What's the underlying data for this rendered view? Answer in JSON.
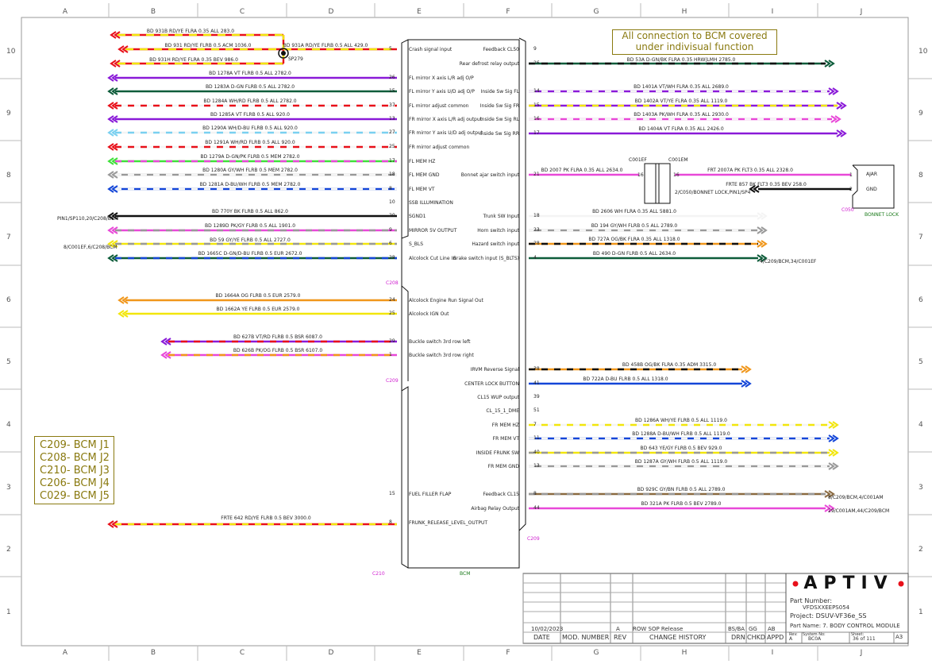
{
  "zones_top": [
    "A",
    "B",
    "C",
    "D",
    "E",
    "F",
    "G",
    "H",
    "I",
    "J"
  ],
  "rows": [
    "10",
    "9",
    "8",
    "7",
    "6",
    "5",
    "4",
    "3",
    "2",
    "1"
  ],
  "note": "All connection to BCM covered under indivisual function",
  "legend": [
    "C209- BCM J1",
    "C208- BCM J2",
    "C210- BCM J3",
    "C206- BCM J4",
    "C029- BCM J5"
  ],
  "component": {
    "label": "BCM",
    "connectors": [
      "C208",
      "C209",
      "C210",
      "C209"
    ]
  },
  "splice": "SP279",
  "left_signals": [
    {
      "pin": "5",
      "label": "Crash signal input"
    },
    {
      "pin": "26",
      "label": "FL mirror X axis L/R adj O/P"
    },
    {
      "pin": "15",
      "label": "FL mirror Y axis U/D adj O/P"
    },
    {
      "pin": "37",
      "label": "FL mirror adjust common"
    },
    {
      "pin": "13",
      "label": "FR mirror X axis L/R adj output"
    },
    {
      "pin": "27",
      "label": "FR mirror Y axis U/D adj output"
    },
    {
      "pin": "25",
      "label": "FR mirror adjust common"
    },
    {
      "pin": "17",
      "label": "FL MEM HZ"
    },
    {
      "pin": "18",
      "label": "FL MEM GND"
    },
    {
      "pin": "8",
      "label": "FL MEM VT"
    },
    {
      "pin": "10",
      "label": "SSB ILLUMINATION"
    },
    {
      "pin": "20",
      "label": "SGND1"
    },
    {
      "pin": "9",
      "label": "MIRROR 5V OUTPUT"
    },
    {
      "pin": "6",
      "label": "S_BLS"
    },
    {
      "pin": "28",
      "label": "Alcolock Cut Line In"
    },
    {
      "pin": "24",
      "label": "Alcolock Engine Run Signal Out"
    },
    {
      "pin": "25",
      "label": "Alcolock IGN Out"
    },
    {
      "pin": "29",
      "label": "Buckle switch 3rd row left"
    },
    {
      "pin": "1",
      "label": "Buckle switch 3rd row right"
    },
    {
      "pin": "15",
      "label": "FUEL FILLER FLAP"
    },
    {
      "pin": "8",
      "label": "FRUNK_RELEASE_LEVEL_OUTPUT"
    }
  ],
  "right_signals": [
    {
      "pin": "9",
      "label": "Feedback CL50"
    },
    {
      "pin": "26",
      "label": "Rear defrost relay output"
    },
    {
      "pin": "14",
      "label": "Inside Sw Sig FL"
    },
    {
      "pin": "15",
      "label": "Inside Sw Sig FR"
    },
    {
      "pin": "16",
      "label": "Inside Sw Sig RL"
    },
    {
      "pin": "17",
      "label": "Inside Sw Sig RR"
    },
    {
      "pin": "21",
      "label": "Bonnet ajar switch input"
    },
    {
      "pin": "18",
      "label": "Trunk SW Input"
    },
    {
      "pin": "23",
      "label": "Horn switch input"
    },
    {
      "pin": "28",
      "label": "Hazard switch input"
    },
    {
      "pin": "4",
      "label": "Brake switch input (S_BLTS)"
    },
    {
      "pin": "38",
      "label": "IRVM Reverse Signal"
    },
    {
      "pin": "41",
      "label": "CENTER LOCK BUTTON"
    },
    {
      "pin": "39",
      "label": "CL15 WUP output"
    },
    {
      "pin": "51",
      "label": "CL_15_1_DME"
    },
    {
      "pin": "7",
      "label": "FR MEM HZ"
    },
    {
      "pin": "11",
      "label": "FR MEM VT"
    },
    {
      "pin": "40",
      "label": "INSIDE FRUNK SW"
    },
    {
      "pin": "13",
      "label": "FR MEM GND"
    },
    {
      "pin": "8",
      "label": "Feedback CL15"
    },
    {
      "pin": "44",
      "label": "Airbag Relay Output"
    }
  ],
  "left_wires": [
    "BD 931B RD/YE FLRA 0.35 ALL 283.0",
    "BD 931 RD/YE FLRB 0.5 ACM 1036.0",
    "BD 931H RD/YE FLRA 0.35 BEV 986.0",
    "BD 931A RD/YE FLRB 0.5 ALL 429.0",
    "BD 1278A VT FLRB 0.5 ALL 2782.0",
    "BD 1283A D-GN FLRB 0.5 ALL 2782.0",
    "BD 1284A WH/RD FLRB 0.5 ALL 2782.0",
    "BD 1285A VT FLRB 0.5 ALL 920.0",
    "BD 1290A WH/D-BU FLRB 0.5 ALL 920.0",
    "BD 1291A WH/RD FLRB 0.5 ALL 920.0",
    "BD 1279A D-GN/PK FLRB 0.5 MEM 2782.0",
    "BD 1280A GY/WH FLRB 0.5 MEM 2782.0",
    "BD 1281A D-BU/WH FLRB 0.5 MEM 2782.0",
    "BD 770Y BK FLRB 0.5 ALL 862.0",
    "BD 1289D PK/GY FLRB 0.5 ALL 1901.0",
    "BD 59 GY/YE FLRB 0.5 ALL 2727.0",
    "BD 1665C D-GN/D-BU FLRB 0.5 EUR 2672.0",
    "BD 1664A OG FLRB 0.5 EUR 2579.0",
    "BD 1662A YE FLRB 0.5 EUR 2579.0",
    "BD 627B VT/RD FLRB 0.5 BSR 6087.0",
    "BD 626B PK/OG FLRB 0.5 BSR 6107.0",
    "FRTE 642 RD/YE FLRB 0.5 BEV 3000.0"
  ],
  "left_ext": [
    "PIN1/SP110,20/C208/BCM",
    "8/C001EF,6/C208/BCM"
  ],
  "right_wires": [
    "BD 53A D-GN/BK FLRA 0.35 HRW|LMH 2785.0",
    "BD 1401A VT/WH FLRA 0.35 ALL 2689.0",
    "BD 1402A VT/YE FLRA 0.35 ALL 1119.0",
    "BD 1403A PK/WH FLRA 0.35 ALL 2930.0",
    "BD 1404A VT FLRA 0.35 ALL 2426.0",
    "BD 2007 PK FLRA 0.35 ALL 2634.0",
    "FRT 2007A PK FLT3 0.35 ALL 2328.0",
    "FRTE 857 BK FLT3 0.35 BEV 258.0",
    "BD 2606 WH FLRA 0.35 ALL 5881.0",
    "BD 194 GY/WH FLRB 0.5 ALL 2789.0",
    "BD 727A OG/BK FLRA 0.35 ALL 1318.0",
    "BD 490 D-GN FLRB 0.5 ALL 2634.0",
    "BD 458B OG/BK FLRA 0.35 ADM 3315.0",
    "BD 722A D-BU FLRB 0.5 ALL 1318.0",
    "BD 1286A WH/YE FLRB 0.5 ALL 1119.0",
    "BD 1288A D-BU/WH FLRB 0.5 ALL 1119.0",
    "BD 643 YE/GY FLRB 0.5 BEV 929.0",
    "BD 1287A GY/WH FLRB 0.5 ALL 1119.0",
    "BD 929C GY/BN FLRB 0.5 ALL 2789.0",
    "BD 321A PK FLRB 0.5 BEV 2789.0"
  ],
  "right_ext": [
    "4/C209/BCM,34/C001EF",
    "8/C209/BCM,4/C001AM",
    "29/C001AM,44/C209/BCM",
    "2/C050/BONNET LOCK,PIN1/SP4"
  ],
  "bonnet": {
    "connectors": [
      "C001EF",
      "C001EM"
    ],
    "pins": [
      "16",
      "16",
      "1",
      "2"
    ],
    "label": "BONNET LOCK",
    "conn": "C050",
    "ajar": "AJAR",
    "gnd": "GND"
  },
  "title_block": {
    "date": "10/02/2023",
    "rev": "A",
    "change": "ROW SOP Release",
    "drn": "BS/BA",
    "chkd": "GG",
    "appd": "AB",
    "hdr": [
      "DATE",
      "MOD. NUMBER",
      "REV",
      "CHANGE HISTORY",
      "DRN",
      "CHKD",
      "APPD"
    ],
    "part_number_label": "Part Number:",
    "part_number": "VFDSXXEEPS054",
    "project": "Project: DSUV-VF36e_SS",
    "part_name": "Part Name: 7. BODY CONTROL MODULE",
    "rev_label": "Rev:",
    "rev_val": "A",
    "sys_label": "System No:",
    "sys_val": "BC0A",
    "sheet_label": "Sheet:",
    "sheet_val": "36 of 111",
    "size": "A3",
    "logo": "APTIV"
  }
}
